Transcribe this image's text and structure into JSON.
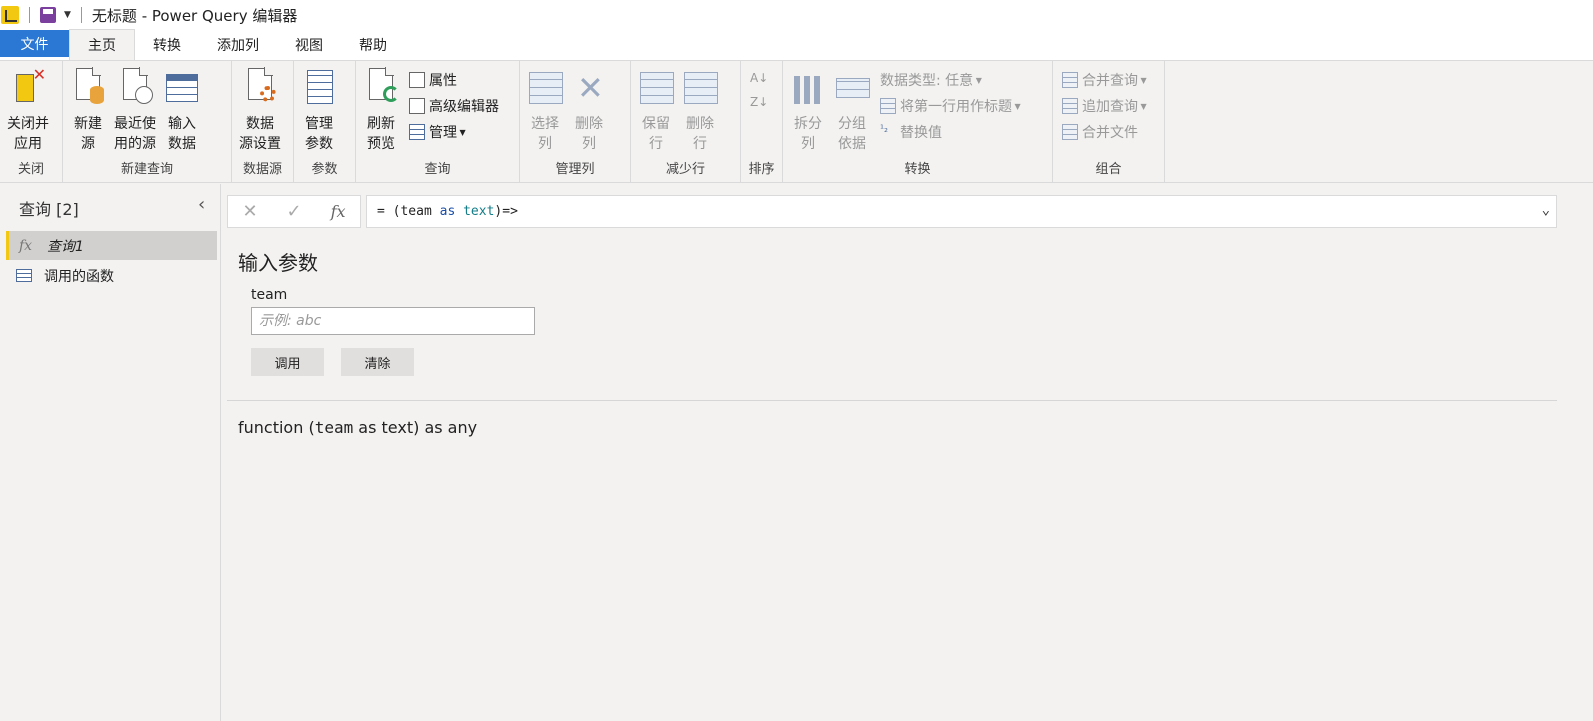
{
  "titlebar": {
    "title": "无标题 - Power Query 编辑器"
  },
  "tabs": {
    "file": "文件",
    "items": [
      "主页",
      "转换",
      "添加列",
      "视图",
      "帮助"
    ]
  },
  "ribbon": {
    "close_group": {
      "label": "关闭",
      "close_apply": "关闭并\n应用"
    },
    "newquery_group": {
      "label": "新建查询",
      "new_source": "新建\n源",
      "recent_sources": "最近使\n用的源",
      "enter_data": "输入\n数据"
    },
    "datasource_group": {
      "label": "数据源",
      "settings": "数据\n源设置"
    },
    "params_group": {
      "label": "参数",
      "manage_params": "管理\n参数"
    },
    "query_group": {
      "label": "查询",
      "refresh": "刷新\n预览",
      "properties": "属性",
      "advanced_editor": "高级编辑器",
      "manage": "管理"
    },
    "managecols_group": {
      "label": "管理列",
      "choose_cols": "选择\n列",
      "remove_cols": "删除\n列"
    },
    "reducerows_group": {
      "label": "减少行",
      "keep_rows": "保留\n行",
      "remove_rows": "删除\n行"
    },
    "sort_group": {
      "label": "排序"
    },
    "transform_group": {
      "label": "转换",
      "split_col": "拆分\n列",
      "group_by": "分组\n依据",
      "data_type": "数据类型: 任意",
      "first_row_header": "将第一行用作标题",
      "replace_values": "替换值"
    },
    "combine_group": {
      "label": "组合",
      "merge_queries": "合并查询",
      "append_queries": "追加查询",
      "combine_files": "合并文件"
    }
  },
  "queries_pane": {
    "title": "查询 [2]",
    "items": [
      {
        "label": "查询1",
        "icon": "fx-icon"
      },
      {
        "label": "调用的函数",
        "icon": "table-icon"
      }
    ]
  },
  "formula_bar": {
    "prefix": "= (team ",
    "kw": "as",
    "type": "text",
    "suffix": ")=>"
  },
  "main": {
    "section_title": "输入参数",
    "param_label": "team",
    "param_placeholder": "示例: abc",
    "invoke_button": "调用",
    "clear_button": "清除",
    "signature_prefix": "function (",
    "signature_param": "team",
    "signature_suffix": " as text) as any"
  },
  "colors": {
    "accent": "#2b78d4",
    "selected_marker": "#f2c811"
  }
}
